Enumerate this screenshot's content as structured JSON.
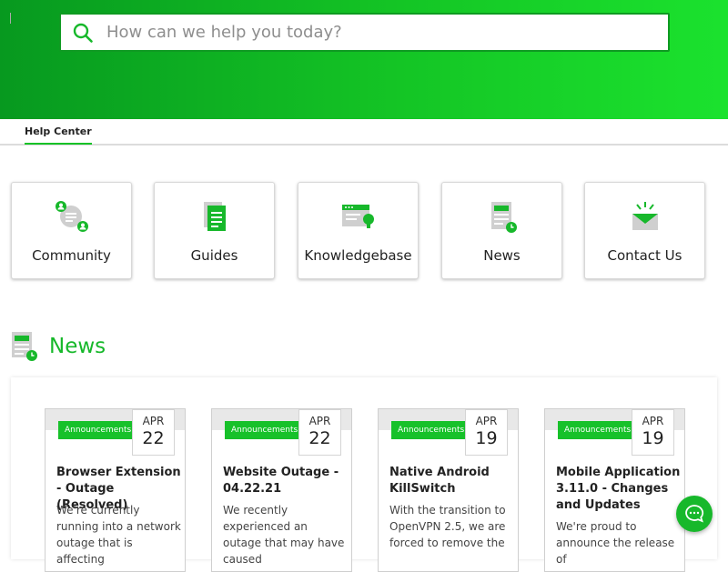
{
  "search": {
    "placeholder": "How can we help you today?"
  },
  "breadcrumb": {
    "label": "Help Center"
  },
  "categories": [
    {
      "label": "Community",
      "icon": "community-icon"
    },
    {
      "label": "Guides",
      "icon": "guides-icon"
    },
    {
      "label": "Knowledgebase",
      "icon": "knowledgebase-icon"
    },
    {
      "label": "News",
      "icon": "news-icon"
    },
    {
      "label": "Contact Us",
      "icon": "contact-icon"
    }
  ],
  "news_section": {
    "title": "News",
    "icon": "news-icon"
  },
  "news": [
    {
      "badge": "Announcements",
      "month": "APR",
      "day": "22",
      "title": "Browser Extension - Outage (Resolved)",
      "excerpt": "We're currently running into a network outage that is affecting"
    },
    {
      "badge": "Announcements",
      "month": "APR",
      "day": "22",
      "title": "Website Outage - 04.22.21",
      "excerpt": "We recently experienced an outage that may have caused"
    },
    {
      "badge": "Announcements",
      "month": "APR",
      "day": "19",
      "title": "Native Android KillSwitch",
      "excerpt": "With the transition to OpenVPN 2.5, we are forced to remove the"
    },
    {
      "badge": "Announcements",
      "month": "APR",
      "day": "19",
      "title": "Mobile Application 3.11.0 - Changes and Updates",
      "excerpt": "We're proud to announce the release of"
    }
  ],
  "colors": {
    "accent": "#16b82a",
    "hero_start": "#07991f",
    "hero_end": "#1be22e"
  },
  "chat": {
    "icon": "chat-icon"
  }
}
